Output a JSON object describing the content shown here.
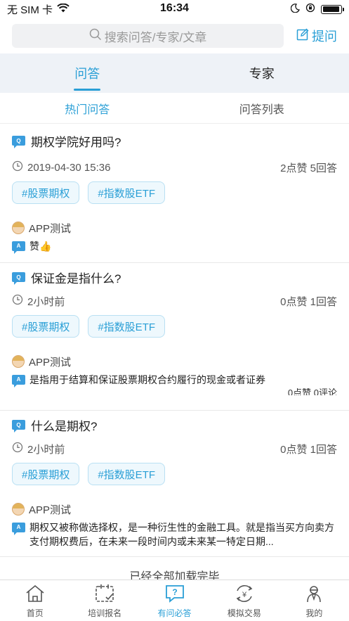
{
  "status": {
    "carrier": "无 SIM 卡",
    "time": "16:34",
    "battery_level": 0.95
  },
  "search": {
    "placeholder": "搜索问答/专家/文章",
    "ask_label": "提问"
  },
  "main_tabs": [
    {
      "label": "问答",
      "active": true
    },
    {
      "label": "专家",
      "active": false
    }
  ],
  "sub_tabs": [
    {
      "label": "热门问答",
      "active": true
    },
    {
      "label": "问答列表",
      "active": false
    }
  ],
  "questions": [
    {
      "title": "期权学院好用吗?",
      "time": "2019-04-30 15:36",
      "stats": "2点赞 5回答",
      "tags": [
        "#股票期权",
        "#指数股ETF"
      ],
      "answer_user": "APP测试",
      "answer": "赞👍",
      "answer_stats": ""
    },
    {
      "title": "保证金是指什么?",
      "time": "2小时前",
      "stats": "0点赞 1回答",
      "tags": [
        "#股票期权",
        "#指数股ETF"
      ],
      "answer_user": "APP测试",
      "answer": "是指用于结算和保证股票期权合约履行的现金或者证券",
      "answer_stats": "0点赞 0评论"
    },
    {
      "title": "什么是期权?",
      "time": "2小时前",
      "stats": "0点赞 1回答",
      "tags": [
        "#股票期权",
        "#指数股ETF"
      ],
      "answer_user": "APP测试",
      "answer": "期权又被称做选择权，是一种衍生性的金融工具。就是指当买方向卖方支付期权费后，在未来一段时间内或未来某一特定日期...",
      "answer_stats": ""
    }
  ],
  "footer_note": "已经全部加载完毕",
  "tabbar": [
    {
      "label": "首页",
      "icon": "home-icon",
      "active": false
    },
    {
      "label": "培训报名",
      "icon": "calendar-check-icon",
      "active": false
    },
    {
      "label": "有问必答",
      "icon": "question-chat-icon",
      "active": true
    },
    {
      "label": "模拟交易",
      "icon": "yen-exchange-icon",
      "active": false
    },
    {
      "label": "我的",
      "icon": "profile-icon",
      "active": false
    }
  ],
  "colors": {
    "accent": "#2a9fd6",
    "badge": "#3a9ddd",
    "tab_bg": "#eef2f7"
  }
}
